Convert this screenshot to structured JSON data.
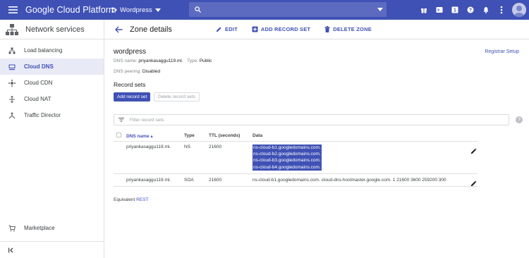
{
  "topbar": {
    "brand": "Google Cloud Platform",
    "project": "Wordpress",
    "search_placeholder": ""
  },
  "sidebar": {
    "title": "Network services",
    "items": [
      {
        "label": "Load balancing",
        "icon": "load-balancing-icon"
      },
      {
        "label": "Cloud DNS",
        "icon": "dns-icon",
        "active": true
      },
      {
        "label": "Cloud CDN",
        "icon": "cdn-icon"
      },
      {
        "label": "Cloud NAT",
        "icon": "nat-icon"
      },
      {
        "label": "Traffic Director",
        "icon": "traffic-director-icon"
      }
    ],
    "marketplace": "Marketplace"
  },
  "actionbar": {
    "title": "Zone details",
    "edit": "EDIT",
    "add_record_set": "ADD RECORD SET",
    "delete_zone": "DELETE ZONE"
  },
  "zone": {
    "name": "wordpress",
    "registrar_setup": "Registrar Setup",
    "dns_name_label": "DNS name:",
    "dns_name": "priyankasaggu119.ml.",
    "type_label": "Type:",
    "type": "Public",
    "dns_peering_label": "DNS peering:",
    "dns_peering": "Disabled"
  },
  "record_sets": {
    "title": "Record sets",
    "add_button": "Add record set",
    "delete_button": "Delete record sets",
    "filter_placeholder": "Filter record sets",
    "columns": [
      "DNS name",
      "Type",
      "TTL (seconds)",
      "Data"
    ],
    "rows": [
      {
        "name": "priyankasaggu119.ml.",
        "type": "NS",
        "ttl": "21600",
        "data": [
          "ns-cloud-b1.googledomains.com.",
          "ns-cloud-b2.googledomains.com.",
          "ns-cloud-b3.googledomains.com.",
          "ns-cloud-b4.googledomains.com."
        ]
      },
      {
        "name": "priyankasaggu119.ml.",
        "type": "SOA",
        "ttl": "21600",
        "data": [
          "ns-cloud-b1.googledomains.com. cloud-dns-hostmaster.google.com. 1 21600 3600 259200 300"
        ]
      }
    ],
    "equivalent_label": "Equivalent",
    "equivalent_link": "REST"
  },
  "colors": {
    "primary": "#3f51b5",
    "search_bg": "#5c6bc0",
    "active_bg": "#e8eaf6"
  }
}
